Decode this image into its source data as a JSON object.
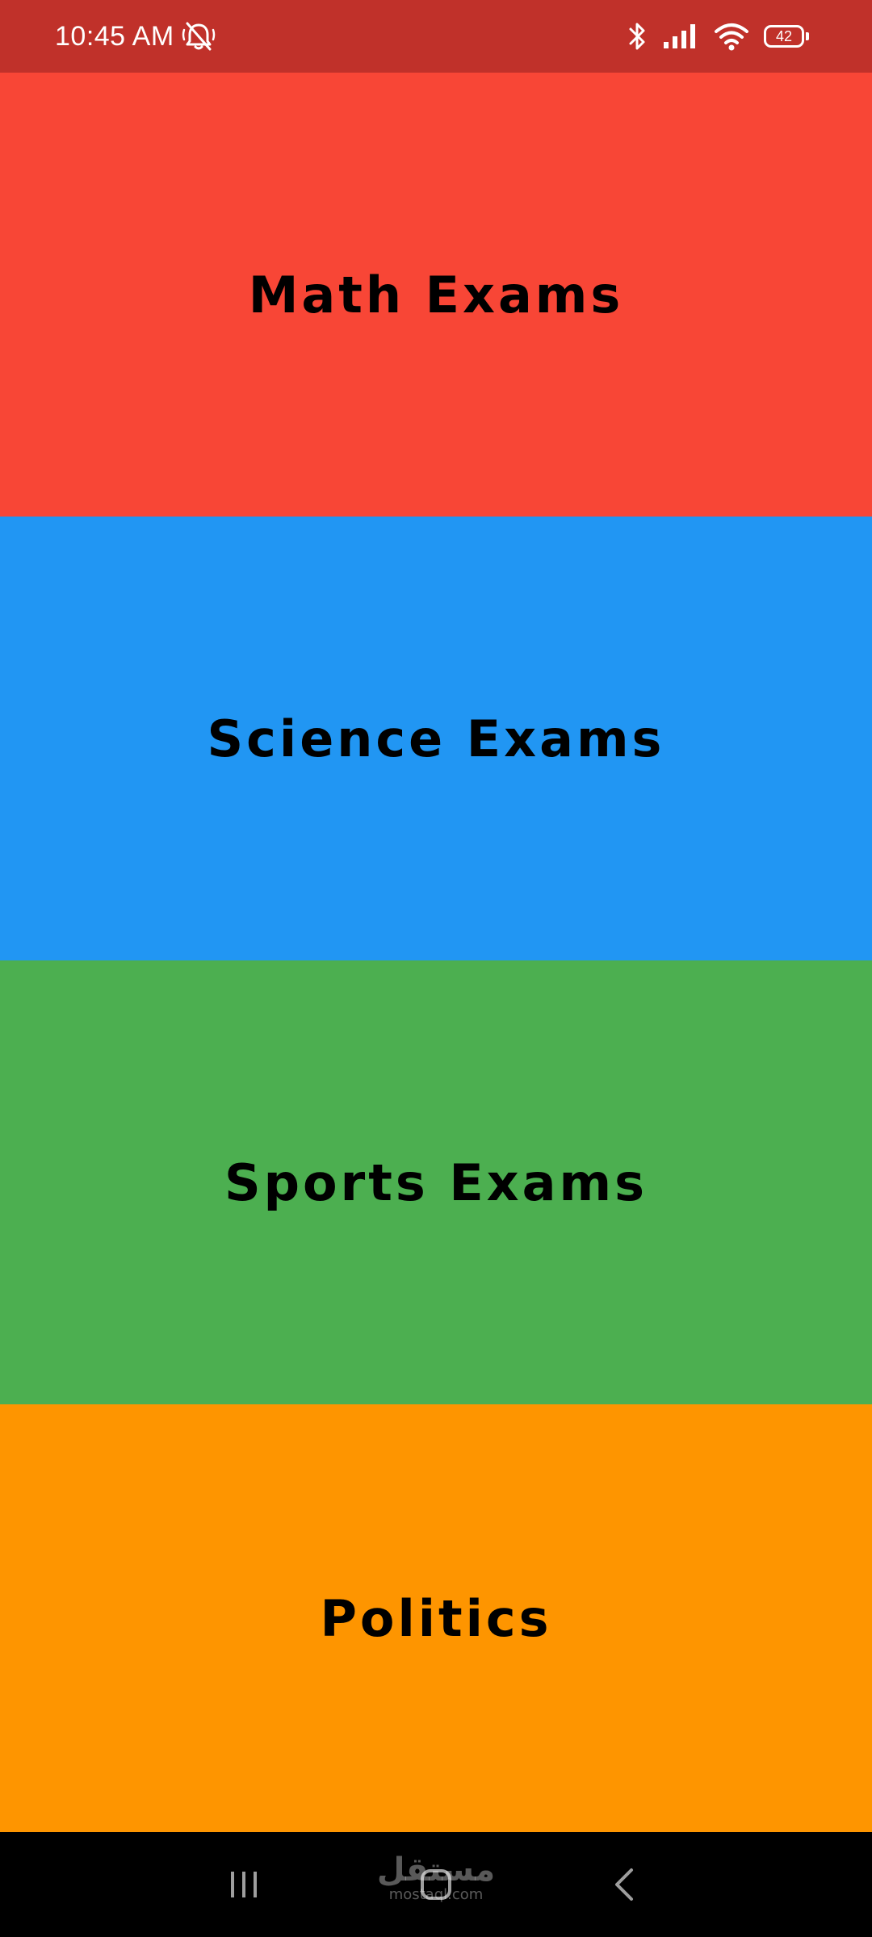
{
  "status_bar": {
    "time": "10:45 AM",
    "battery_level": "42",
    "background_color": "#c0312a",
    "icons": [
      "alarm-off-icon",
      "bluetooth-icon",
      "cell-signal-icon",
      "wifi-icon",
      "battery-icon"
    ]
  },
  "categories": [
    {
      "label": "Math Exams",
      "color": "#f84636"
    },
    {
      "label": "Science Exams",
      "color": "#2196f3"
    },
    {
      "label": "Sports Exams",
      "color": "#4caf50"
    },
    {
      "label": "Politics",
      "color": "#fe9500"
    }
  ],
  "nav_bar": {
    "icons": [
      "recents-icon",
      "home-icon",
      "back-icon"
    ]
  },
  "watermark": {
    "logo": "مستقل",
    "site": "mostaql.com"
  }
}
